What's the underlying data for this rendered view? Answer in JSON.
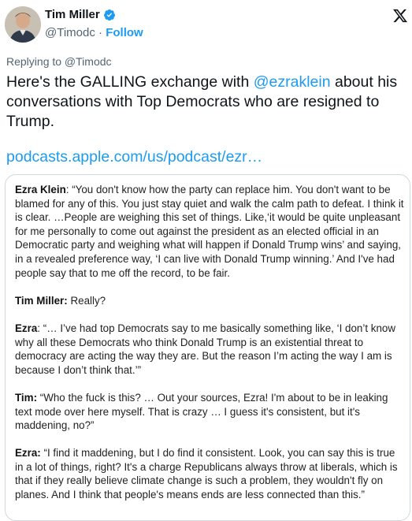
{
  "author": {
    "name": "Tim Miller",
    "handle": "@Timodc",
    "separator": "·",
    "follow_label": "Follow"
  },
  "icons": {
    "verified": "verified-badge-icon",
    "platform": "x-logo-icon"
  },
  "colors": {
    "accent": "#1d9bf0",
    "muted": "#536471",
    "text": "#0f1419"
  },
  "replying": "Replying to @Timodc",
  "tweet": {
    "text_part1": "Here's the GALLING exchange with ",
    "mention": "@ezraklein",
    "text_part2": " about his conversations with Top Democrats who are resigned to Trump.",
    "link": "podcasts.apple.com/us/podcast/ezr…"
  },
  "quote": [
    {
      "speaker": "Ezra Klein",
      "sep": ": ",
      "text": "“You don't know how the party can replace him. You don't want to be blamed for any of this. You just stay quiet and walk the calm path to defeat. I think it is clear. …People are weighing this set of things. Like,‘it would be quite unpleasant for me personally to come out against the president as an elected official in an Democratic party and weighing what will happen if Donald Trump wins’ and saying, in a revealed preference way, ‘I can live with Donald Trump winning.’ And I've had people say that to me off the record, to be fair."
    },
    {
      "speaker": "Tim Miller:",
      "sep": " ",
      "text": "Really?"
    },
    {
      "speaker": "Ezra",
      "sep": ": ",
      "text": "“… I’ve had top Democrats say to me basically something like, ‘I don’t know why all these Democrats who think Donald Trump is an existential threat to democracy are acting the way they are. But the reason I’m acting the way I am is because I don’t think that.’”"
    },
    {
      "speaker": "Tim:",
      "sep": " ",
      "text": "“Who the fuck is this? … Out your sources, Ezra! I'm about to be in leaking text mode over here myself. That is crazy … I guess it's consistent, but it's maddening, no?”"
    },
    {
      "speaker": "Ezra:",
      "sep": " ",
      "text": "“I find it maddening, but I do find it consistent. Look, you can say this is true in a lot of things, right? It's a charge Republicans always throw at liberals, which is that if they really believe climate change is such a problem, they wouldn't fly on planes. And I think that people's means ends are less connected than this.”"
    }
  ]
}
